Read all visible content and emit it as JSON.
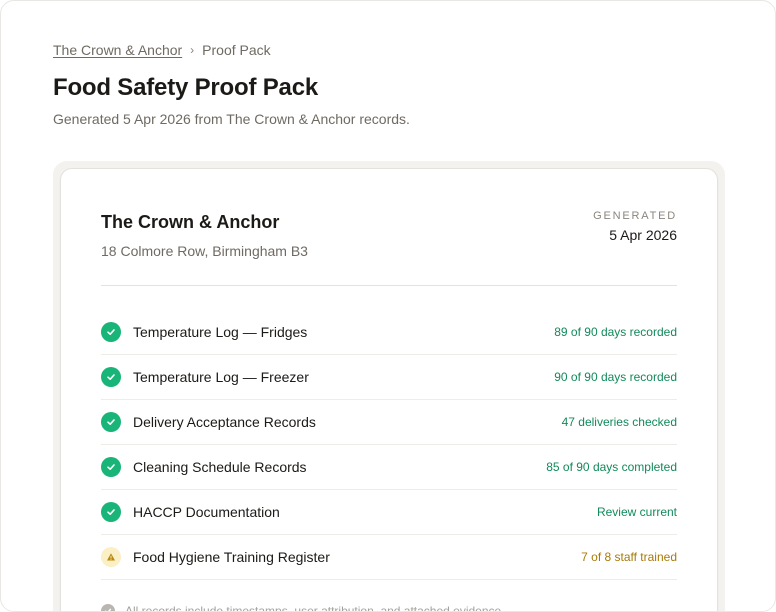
{
  "breadcrumb": {
    "parent": "The Crown & Anchor",
    "separator": "›",
    "current": "Proof Pack"
  },
  "page": {
    "title": "Food Safety Proof Pack",
    "subtitle": "Generated 5 Apr 2026 from The Crown & Anchor records."
  },
  "card": {
    "venue_name": "The Crown & Anchor",
    "venue_address": "18 Colmore Row, Birmingham B3",
    "generated_label": "GENERATED",
    "generated_date": "5 Apr 2026"
  },
  "records": [
    {
      "label": "Temperature Log — Fridges",
      "status": "89 of 90 days recorded",
      "state": "ok",
      "icon": "check-icon"
    },
    {
      "label": "Temperature Log — Freezer",
      "status": "90 of 90 days recorded",
      "state": "ok",
      "icon": "check-icon"
    },
    {
      "label": "Delivery Acceptance Records",
      "status": "47 deliveries checked",
      "state": "ok",
      "icon": "check-icon"
    },
    {
      "label": "Cleaning Schedule Records",
      "status": "85 of 90 days completed",
      "state": "ok",
      "icon": "check-icon"
    },
    {
      "label": "HACCP Documentation",
      "status": "Review current",
      "state": "ok",
      "icon": "check-icon"
    },
    {
      "label": "Food Hygiene Training Register",
      "status": "7 of 8 staff trained",
      "state": "warn",
      "icon": "warning-icon"
    }
  ],
  "footer_note": "All records include timestamps, user attribution, and attached evidence.",
  "colors": {
    "ok": "#18b478",
    "ok_text": "#128a5a",
    "warn_bg": "#fbefc6",
    "warn_text": "#a87a08"
  }
}
